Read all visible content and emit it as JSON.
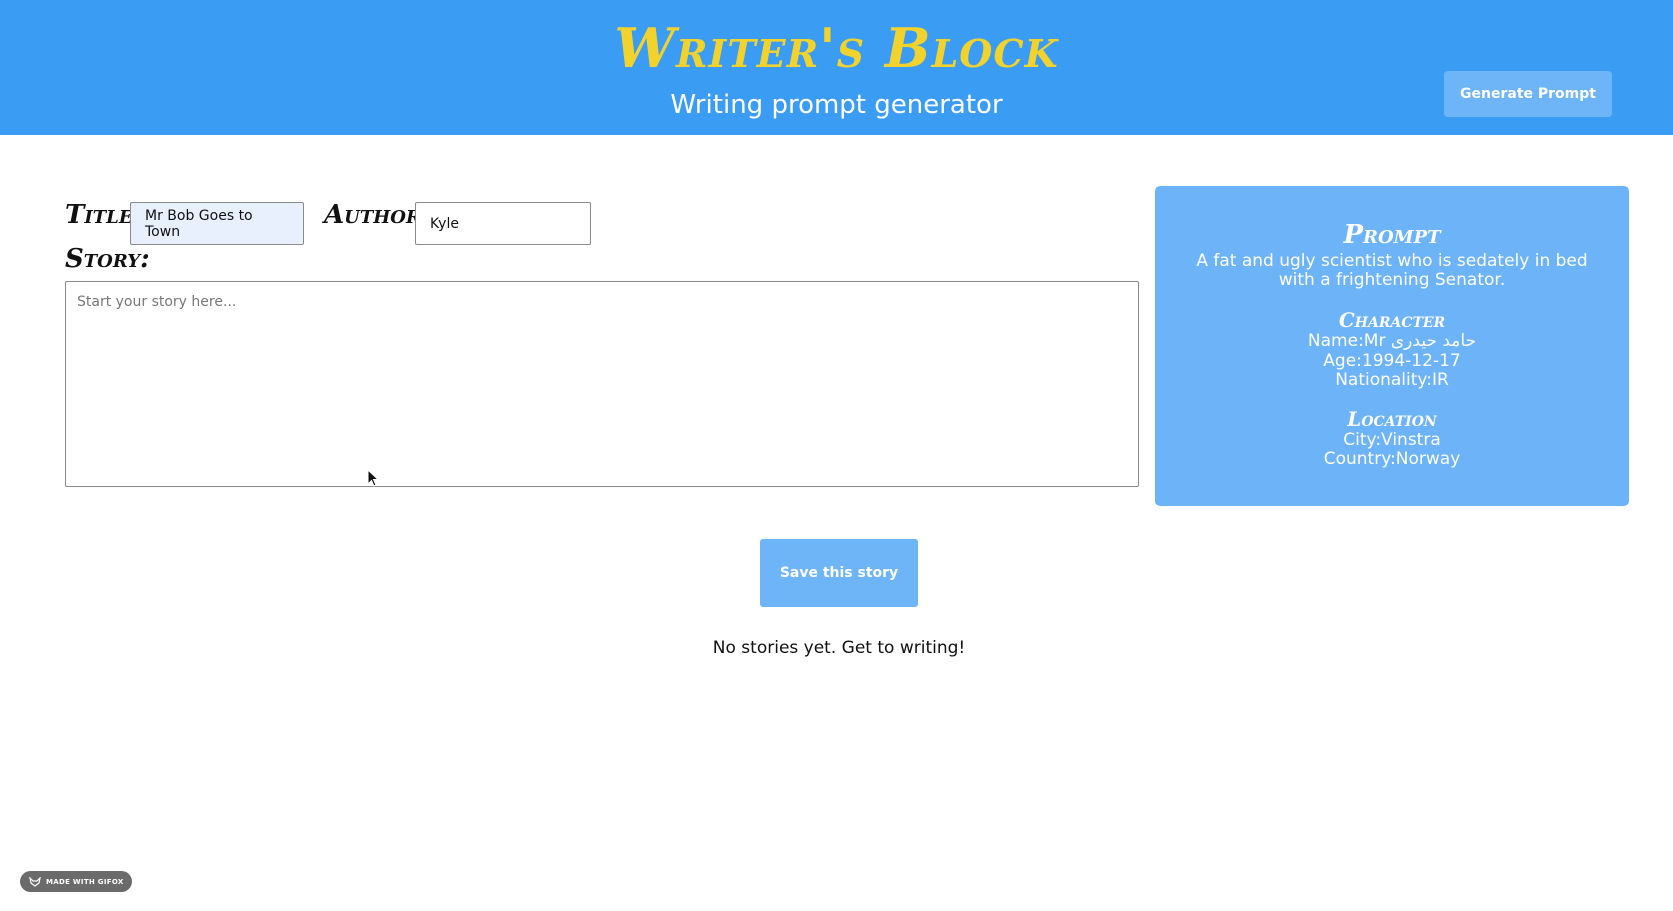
{
  "header": {
    "title": "Writer's Block",
    "subtitle": "Writing prompt generator",
    "generate_button": "Generate Prompt"
  },
  "form": {
    "title_label": "Title:",
    "title_value": "Mr Bob Goes to Town",
    "author_label": "Author:",
    "author_value": "Kyle",
    "story_label": "Story:",
    "story_placeholder": "Start your story here..."
  },
  "prompt_card": {
    "heading": "Prompt",
    "text": "A fat and ugly scientist who is sedately in bed with a frightening Senator.",
    "character_heading": "Character",
    "character_name": "Name:Mr حامد حیدری",
    "character_age": "Age:1994-12-17",
    "character_nationality": "Nationality:IR",
    "location_heading": "Location",
    "location_city": "City:Vinstra",
    "location_country": "Country:Norway"
  },
  "actions": {
    "save_button": "Save this story"
  },
  "stories": {
    "empty_message": "No stories yet. Get to writing!"
  },
  "badge": {
    "label": "MADE WITH GIFOX",
    "icon": "fox-icon"
  },
  "colors": {
    "header_bg": "#3b9cf3",
    "title_yellow": "#f2d32e",
    "card_bg": "#6cb4f7",
    "button_bg": "#6db5f6"
  }
}
